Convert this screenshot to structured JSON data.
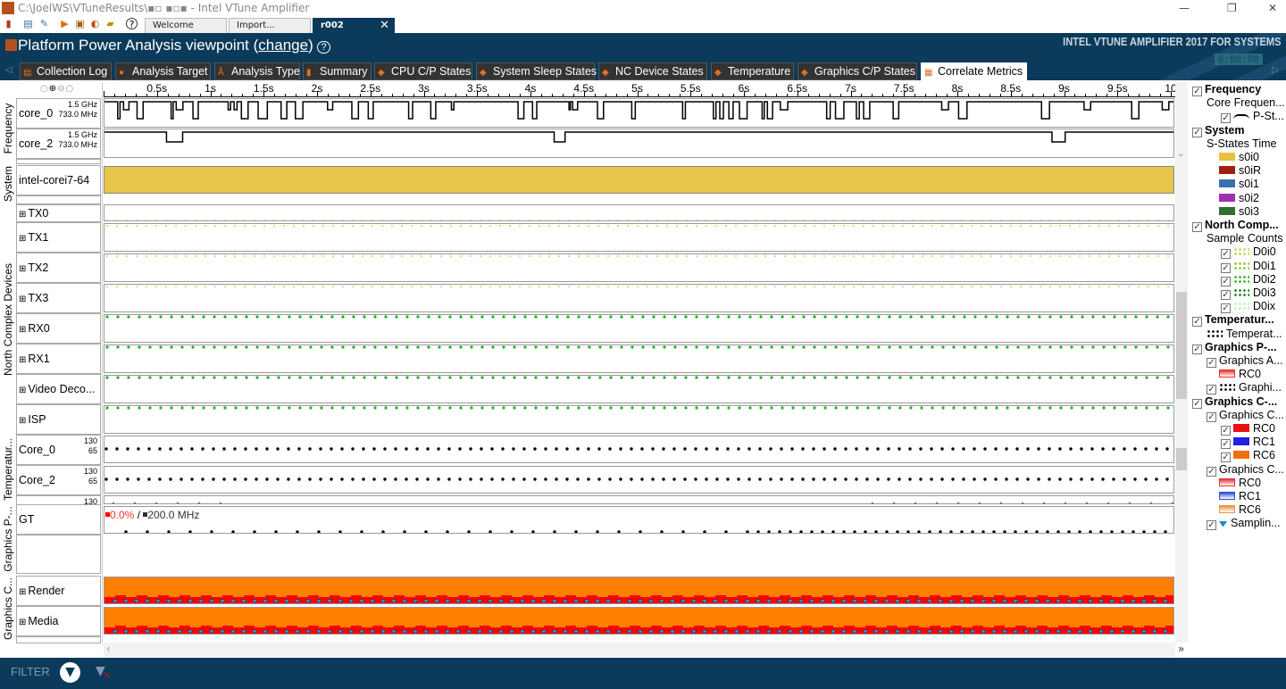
{
  "window": {
    "title": "C:\\JoelWS\\VTuneResults\\▪▫ ▪▫▪ - Intel VTune Amplifier"
  },
  "doc_tabs": [
    "Welcome",
    "Import...",
    "r002"
  ],
  "header": {
    "title_prefix": "Platform Power Analysis viewpoint (",
    "change_link": "change",
    "title_suffix": ")",
    "help": "?",
    "brand": "INTEL VTUNE AMPLIFIER 2017 FOR SYSTEMS",
    "timer": "0:00:00"
  },
  "analysis_tabs": [
    "Collection Log",
    "Analysis Target",
    "Analysis Type",
    "Summary",
    "CPU C/P States",
    "System Sleep States",
    "NC Device States",
    "Temperature",
    "Graphics C/P States",
    "Correlate Metrics"
  ],
  "timeline": {
    "ticks": [
      "0.5s",
      "1s",
      "1.5s",
      "2s",
      "2.5s",
      "3s",
      "3.5s",
      "4s",
      "4.5s",
      "5s",
      "5.5s",
      "6s",
      "6.5s",
      "7s",
      "7.5s",
      "8s",
      "8.5s",
      "9s",
      "9.5s",
      "10"
    ]
  },
  "groups": [
    "Frequency",
    "System",
    "North Complex Devices",
    "Temperatur...",
    "Graphics P-...",
    "Graphics C..."
  ],
  "rows": {
    "core_0": {
      "name": "core_0",
      "max": "1.5 GHz",
      "min": "733.0 MHz"
    },
    "core_2": {
      "name": "core_2",
      "max": "1.5 GHz",
      "min": "733.0 MHz"
    },
    "system": {
      "name": "intel-corei7-64"
    },
    "nc": [
      "TX0",
      "TX1",
      "TX2",
      "TX3",
      "RX0",
      "RX1",
      "Video Deco...",
      "ISP"
    ],
    "temp0": {
      "name": "Core_0",
      "max": "130",
      "min": "65"
    },
    "temp2": {
      "name": "Core_2",
      "max": "130",
      "min": "65"
    },
    "temp_partial": "130",
    "gt": {
      "name": "GT",
      "pct": "0.0%",
      "sep": " / ",
      "freq": "200.0 MHz"
    },
    "render": "Render",
    "media": "Media"
  },
  "legend": [
    {
      "t": "Frequency",
      "b": 1,
      "cb": 1,
      "i": 0
    },
    {
      "t": "Core Frequen...",
      "i": 1
    },
    {
      "t": "P-St...",
      "cb": 1,
      "i": 2,
      "sw": "#000",
      "kind": "line"
    },
    {
      "t": "System",
      "b": 1,
      "cb": 1,
      "i": 0
    },
    {
      "t": "S-States Time",
      "i": 1
    },
    {
      "t": "s0i0",
      "i": 2,
      "sw": "#e8c040"
    },
    {
      "t": "s0iR",
      "i": 2,
      "sw": "#a02010"
    },
    {
      "t": "s0i1",
      "i": 2,
      "sw": "#3a70b0"
    },
    {
      "t": "s0i2",
      "i": 2,
      "sw": "#a030b0"
    },
    {
      "t": "s0i3",
      "i": 2,
      "sw": "#307030"
    },
    {
      "t": "North Comp...",
      "b": 1,
      "cb": 1,
      "i": 0
    },
    {
      "t": "Sample Counts",
      "i": 1
    },
    {
      "t": "D0i0",
      "cb": 1,
      "i": 2,
      "sw": "#b0e040",
      "kind": "dots"
    },
    {
      "t": "D0i1",
      "cb": 1,
      "i": 2,
      "sw": "#80d020",
      "kind": "dots"
    },
    {
      "t": "D0i2",
      "cb": 1,
      "i": 2,
      "sw": "#30b020",
      "kind": "dots"
    },
    {
      "t": "D0i3",
      "cb": 1,
      "i": 2,
      "sw": "#108010",
      "kind": "dots"
    },
    {
      "t": "D0ix",
      "cb": 1,
      "i": 2,
      "sw": "#c0f0c0",
      "kind": "dots"
    },
    {
      "t": "Temperatur...",
      "b": 1,
      "cb": 1,
      "i": 0
    },
    {
      "t": "Temperat...",
      "i": 1,
      "sw": "#000",
      "kind": "dots"
    },
    {
      "t": "Graphics P-...",
      "b": 1,
      "cb": 1,
      "i": 0
    },
    {
      "t": "Graphics A...",
      "cb": 1,
      "i": 1
    },
    {
      "t": "RC0",
      "i": 2,
      "sw": "#e83030",
      "kind": "bar"
    },
    {
      "t": "Graphi...",
      "cb": 1,
      "i": 1,
      "sw": "#000",
      "kind": "dots"
    },
    {
      "t": "Graphics C-...",
      "b": 1,
      "cb": 1,
      "i": 0
    },
    {
      "t": "Graphics C...",
      "cb": 1,
      "i": 1
    },
    {
      "t": "RC0",
      "cb": 1,
      "i": 2,
      "sw": "#e81010"
    },
    {
      "t": "RC1",
      "cb": 1,
      "i": 2,
      "sw": "#2020e0"
    },
    {
      "t": "RC6",
      "cb": 1,
      "i": 2,
      "sw": "#f07010"
    },
    {
      "t": "Graphics C...",
      "cb": 1,
      "i": 1
    },
    {
      "t": "RC0",
      "i": 2,
      "sw": "#e83030",
      "kind": "bar"
    },
    {
      "t": "RC1",
      "i": 2,
      "sw": "#3050d0",
      "kind": "bar"
    },
    {
      "t": "RC6",
      "i": 2,
      "sw": "#f09040",
      "kind": "bar"
    },
    {
      "t": "Samplin...",
      "cb": 1,
      "i": 1,
      "sw": "#1a8ad0",
      "kind": "tri"
    }
  ],
  "footer": {
    "filter": "FILTER"
  },
  "colors": {
    "navy": "#0b3a5a",
    "system": "#e5c54a",
    "rc6": "#ff7f00",
    "rc0": "#ff0000"
  }
}
